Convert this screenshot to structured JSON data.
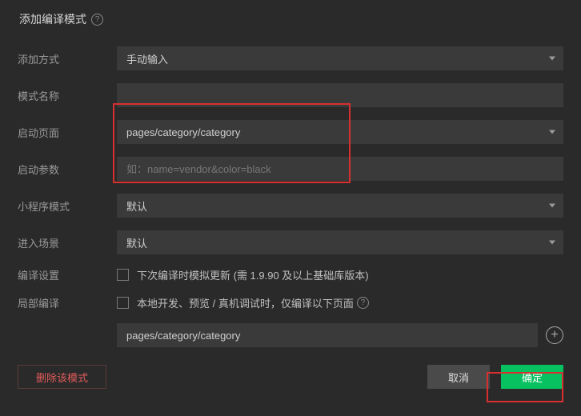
{
  "header": {
    "title": "添加编译模式",
    "help_icon": "?"
  },
  "labels": {
    "add_method": "添加方式",
    "mode_name": "模式名称",
    "start_page": "启动页面",
    "start_params": "启动参数",
    "mini_mode": "小程序模式",
    "enter_scene": "进入场景",
    "compile_settings": "编译设置",
    "partial_compile": "局部编译"
  },
  "fields": {
    "add_method": {
      "value": "手动输入"
    },
    "mode_name": {
      "value": ""
    },
    "start_page": {
      "value": "pages/category/category"
    },
    "start_params": {
      "value": "",
      "placeholder": "如：name=vendor&color=black"
    },
    "mini_mode": {
      "value": "默认"
    },
    "enter_scene": {
      "value": "默认"
    }
  },
  "checkboxes": {
    "simulate_update": {
      "label": "下次编译时模拟更新 (需 1.9.90 及以上基础库版本)"
    },
    "local_dev": {
      "label": "本地开发、预览 / 真机调试时，仅编译以下页面 ",
      "help": "?"
    }
  },
  "pages_input": {
    "value": "pages/category/category"
  },
  "buttons": {
    "delete": "删除该模式",
    "cancel": "取消",
    "ok": "确定",
    "add": "+"
  }
}
